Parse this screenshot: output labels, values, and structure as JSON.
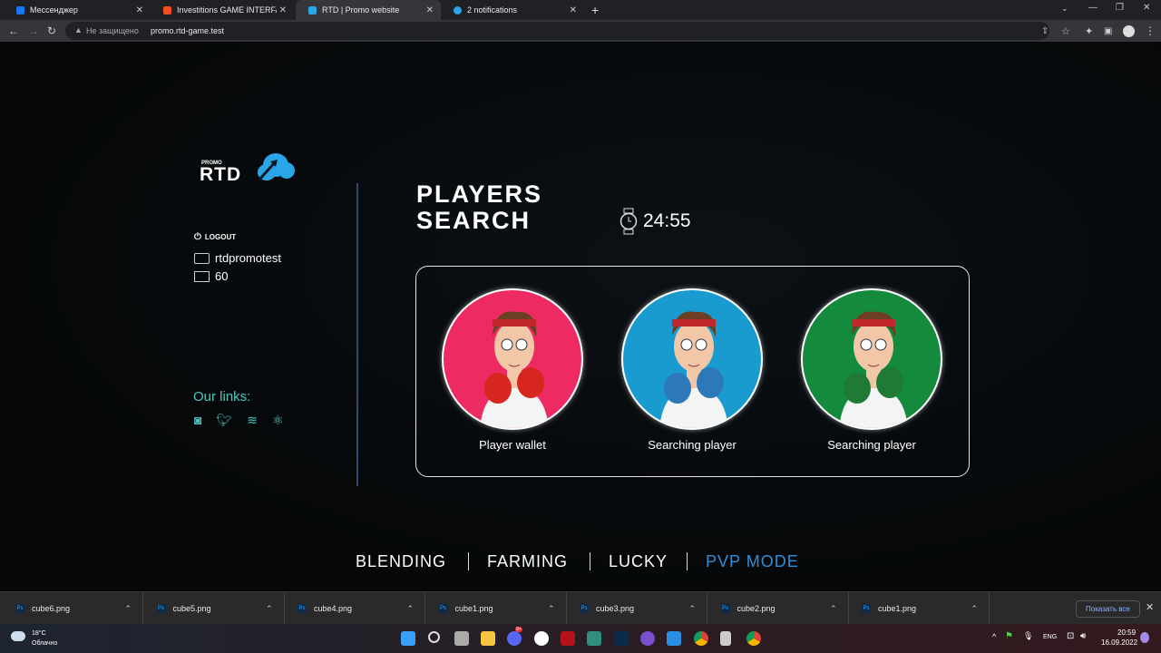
{
  "browser": {
    "tabs": [
      {
        "title": "Мессенджер"
      },
      {
        "title": "Investitions GAME INTERFACE – Figma"
      },
      {
        "title": "RTD | Promo website"
      },
      {
        "title": "2 notifications"
      }
    ],
    "security": "Не защищено",
    "url": "promo.rtd-game.test"
  },
  "sidebar": {
    "logo_small": "PROMO",
    "logo": "RTD",
    "logout": "LOGOUT",
    "username": "rtdpromotest",
    "tickets": "60",
    "links_title": "Our links:"
  },
  "main": {
    "title_line1": "PLAYERS",
    "title_line2": "SEARCH",
    "timer": "24:55",
    "players": [
      {
        "label": "Player wallet",
        "color": "#ee2a62",
        "glove": "#d7261e"
      },
      {
        "label": "Searching player",
        "color": "#1a9bd0",
        "glove": "#2c78b8"
      },
      {
        "label": "Searching player",
        "color": "#138a3c",
        "glove": "#1f7a36"
      }
    ]
  },
  "nav": [
    {
      "label": "BLENDING"
    },
    {
      "label": "FARMING"
    },
    {
      "label": "LUCKY"
    },
    {
      "label": "PVP MODE",
      "active": true
    }
  ],
  "downloads": {
    "items": [
      "cube6.png",
      "cube5.png",
      "cube4.png",
      "cube1.png",
      "cube3.png",
      "cube2.png",
      "cube1.png"
    ],
    "show_all": "Показать все"
  },
  "taskbar": {
    "temp": "18°C",
    "weather": "Облачно",
    "lang": "ENG",
    "time": "20:59",
    "date": "16.09.2022",
    "discord_badge": "9+"
  }
}
